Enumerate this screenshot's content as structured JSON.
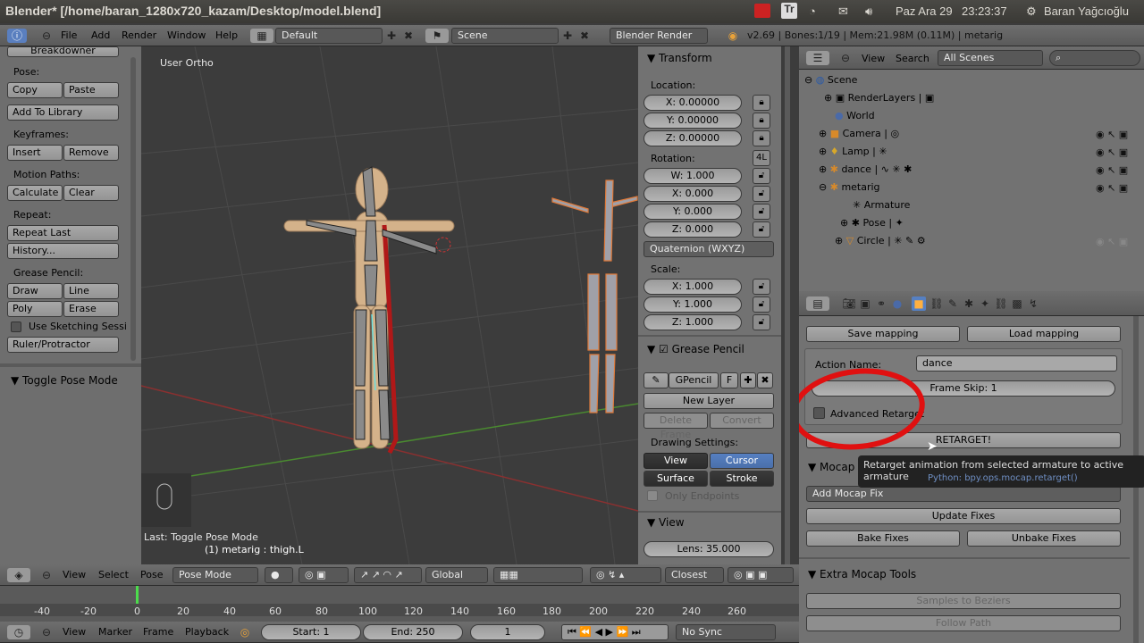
{
  "titlebar": {
    "title": "Blender* [/home/baran_1280x720_kazam/Desktop/model.blend]",
    "date": "Paz Ara 29",
    "time": "23:23:37",
    "user": "Baran Yağcıoğlu"
  },
  "topmenu": {
    "items": [
      "File",
      "Add",
      "Render",
      "Window",
      "Help"
    ],
    "layout": "Default",
    "scene": "Scene",
    "engine": "Blender Render",
    "stats": "v2.69 | Bones:1/19 | Mem:21.98M (0.11M) | metarig"
  },
  "toolshelf": {
    "top_btn": "Breakdowner",
    "pose_label": "Pose:",
    "copy": "Copy",
    "paste": "Paste",
    "add_library": "Add To Library",
    "keyframes_label": "Keyframes:",
    "insert": "Insert",
    "remove": "Remove",
    "motion_label": "Motion Paths:",
    "calculate": "Calculate",
    "clear": "Clear",
    "repeat_label": "Repeat:",
    "repeat_last": "Repeat Last",
    "history": "History...",
    "grease_label": "Grease Pencil:",
    "draw": "Draw",
    "line": "Line",
    "poly": "Poly",
    "erase": "Erase",
    "sketch": "Use Sketching Sessi",
    "ruler": "Ruler/Protractor",
    "toggle_pose": "Toggle Pose Mode"
  },
  "viewport": {
    "view_label": "User Ortho",
    "last_op": "Last: Toggle Pose Mode",
    "selection": "(1) metarig : thigh.L"
  },
  "props": {
    "transform": "Transform",
    "location": "Location:",
    "loc": [
      "X: 0.00000",
      "Y: 0.00000",
      "Z: 0.00000"
    ],
    "rotation": "Rotation:",
    "rot_mode_btn": "4L",
    "rot": [
      "W: 1.000",
      "X: 0.000",
      "Y: 0.000",
      "Z: 0.000"
    ],
    "rot_type": "Quaternion (WXYZ)",
    "scale": "Scale:",
    "scl": [
      "X: 1.000",
      "Y: 1.000",
      "Z: 1.000"
    ],
    "grease": "Grease Pencil",
    "gpencil": "GPencil",
    "f": "F",
    "new_layer": "New Layer",
    "delete_frame": "Delete Frame",
    "convert": "Convert",
    "drawing_settings": "Drawing Settings:",
    "view_btn": "View",
    "cursor_btn": "Cursor",
    "surface_btn": "Surface",
    "stroke_btn": "Stroke",
    "only_endpoints": "Only Endpoints",
    "view_panel": "View",
    "lens": "Lens: 35.000"
  },
  "outliner": {
    "view": "View",
    "search": "Search",
    "filter": "All Scenes",
    "rows": [
      "Scene",
      "RenderLayers",
      "World",
      "Camera",
      "Lamp",
      "dance",
      "metarig",
      "Armature",
      "Pose",
      "Circle"
    ]
  },
  "mocap": {
    "save_mapping": "Save mapping",
    "load_mapping": "Load mapping",
    "action_name_label": "Action Name:",
    "action_name": "dance",
    "frame_skip": "Frame Skip: 1",
    "advanced": "Advanced Retarget",
    "retarget": "RETARGET!",
    "tooltip": "Retarget animation from selected armature to active armature",
    "tooltip_py": "Python: bpy.ops.mocap.retarget()",
    "mocap_label": "Mocap",
    "add_fix": "Add Mocap Fix",
    "update_fixes": "Update Fixes",
    "bake_fixes": "Bake Fixes",
    "unbake_fixes": "Unbake Fixes",
    "extra": "Extra Mocap Tools",
    "samples": "Samples to Beziers",
    "follow": "Follow Path"
  },
  "view3d_header": {
    "view": "View",
    "select": "Select",
    "pose": "Pose",
    "mode": "Pose Mode",
    "orientation": "Global",
    "snap": "Closest"
  },
  "timeline": {
    "ticks": [
      "-40",
      "-20",
      "0",
      "20",
      "40",
      "60",
      "80",
      "100",
      "120",
      "140",
      "160",
      "180",
      "200",
      "220",
      "240",
      "260"
    ],
    "view": "View",
    "marker": "Marker",
    "frame": "Frame",
    "playback": "Playback",
    "start": "Start: 1",
    "end": "End: 250",
    "current": "1",
    "sync": "No Sync"
  }
}
